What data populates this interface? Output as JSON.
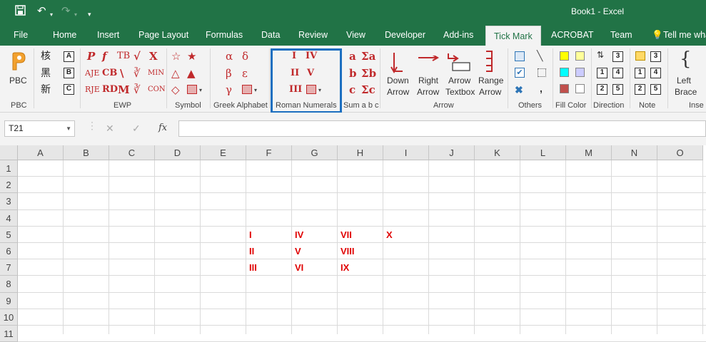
{
  "window": {
    "title": "Book1  -  Excel"
  },
  "quick_access": [
    "save-icon",
    "undo-icon",
    "redo-icon",
    "customize-icon"
  ],
  "tabs": [
    {
      "label": "File"
    },
    {
      "label": "Home"
    },
    {
      "label": "Insert"
    },
    {
      "label": "Page Layout"
    },
    {
      "label": "Formulas"
    },
    {
      "label": "Data"
    },
    {
      "label": "Review"
    },
    {
      "label": "View"
    },
    {
      "label": "Developer"
    },
    {
      "label": "Add-ins"
    },
    {
      "label": "Tick Mark",
      "active": true
    },
    {
      "label": "ACROBAT"
    },
    {
      "label": "Team"
    },
    {
      "label": "Tell me wha"
    }
  ],
  "ribbon": {
    "groups": {
      "pbc": "PBC",
      "ewp": "EWP",
      "symbol": "Symbol",
      "greek": "Greek Alphabet",
      "roman": "Roman Numerals",
      "sum": "Sum a b c",
      "arrow": "Arrow",
      "others": "Others",
      "fillcolor": "Fill Color",
      "direction": "Direction",
      "note": "Note",
      "insert": "Inse"
    },
    "pbc_button": "PBC",
    "boxed_letters": [
      "A",
      "B",
      "C"
    ],
    "cjk_glyphs": [
      "核",
      "黑",
      "新"
    ],
    "ewp_glyphs": [
      "P",
      "f",
      "TB",
      "√",
      "X",
      "AJE",
      "CB",
      "\\",
      "∛",
      "MIN",
      "RJE",
      "RD",
      "M",
      "∛",
      "CON"
    ],
    "symbol_glyphs": [
      "☆",
      "★",
      "△",
      "▲",
      "◇"
    ],
    "greek_glyphs": [
      "α",
      "δ",
      "β",
      "ε",
      "γ"
    ],
    "roman_glyphs": [
      "I",
      "IV",
      "II",
      "V",
      "III"
    ],
    "sum_glyphs": [
      "a",
      "Σa",
      "b",
      "Σb",
      "c",
      "Σc"
    ],
    "arrows": [
      {
        "line1": "Down",
        "line2": "Arrow"
      },
      {
        "line1": "Right",
        "line2": "Arrow"
      },
      {
        "line1": "Arrow",
        "line2": "Textbox"
      },
      {
        "line1": "Range",
        "line2": "Arrow"
      }
    ],
    "direction_nums": [
      "3",
      "4",
      "2",
      "1",
      "5"
    ],
    "note_nums": [
      "3",
      "1",
      "4",
      "2",
      "5"
    ],
    "left_brace": {
      "line1": "Left",
      "line2": "Brace"
    },
    "colors": {
      "yellow": "#ffff00",
      "light_yellow": "#ffff99",
      "cyan": "#00ffff",
      "lavender": "#ccccff",
      "rose": "#c0504d",
      "white": "#ffffff",
      "accent": "#217346",
      "highlight": "#1c6fc0",
      "glyph_red": "#c0292b"
    }
  },
  "formula_bar": {
    "name_box": "T21",
    "cancel": "✕",
    "enter": "✓",
    "fx": "fx",
    "value": ""
  },
  "columns": [
    "A",
    "B",
    "C",
    "D",
    "E",
    "F",
    "G",
    "H",
    "I",
    "J",
    "K",
    "L",
    "M",
    "N",
    "O"
  ],
  "rows": [
    "1",
    "2",
    "3",
    "4",
    "5",
    "6",
    "7",
    "8",
    "9",
    "10",
    "11"
  ],
  "cells": {
    "F5": "I",
    "G5": "IV",
    "H5": "VII",
    "I5": "X",
    "F6": "II",
    "G6": "V",
    "H6": "VIII",
    "F7": "III",
    "G7": "VI",
    "H7": "IX"
  }
}
